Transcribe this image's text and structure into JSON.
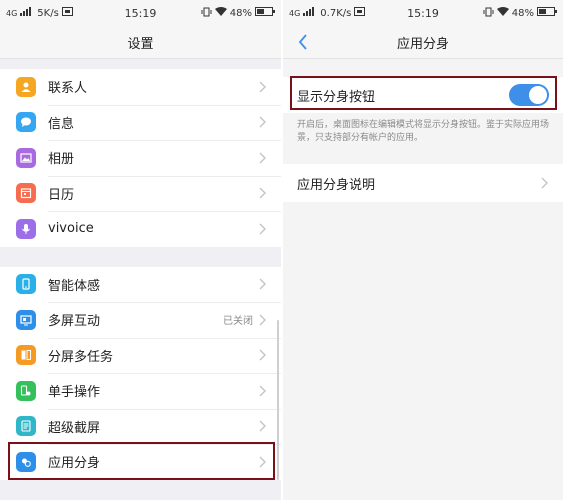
{
  "left_screen": {
    "status_bar": {
      "network": "4G",
      "speed": "5K/s",
      "time": "15:19",
      "battery": "48%"
    },
    "title": "设置",
    "group1": [
      {
        "label": "联系人",
        "icon": "contacts-icon",
        "color": "#f5a623"
      },
      {
        "label": "信息",
        "icon": "message-icon",
        "color": "#35a7f2"
      },
      {
        "label": "相册",
        "icon": "album-icon",
        "color": "#a969e0"
      },
      {
        "label": "日历",
        "icon": "calendar-icon",
        "color": "#f56c4e"
      },
      {
        "label": "vivoice",
        "icon": "microphone-icon",
        "color": "#9c6fe8"
      }
    ],
    "group2": [
      {
        "label": "智能体感",
        "icon": "motion-icon",
        "color": "#2ab0e8",
        "status": ""
      },
      {
        "label": "多屏互动",
        "icon": "multiscreen-icon",
        "color": "#2d8fe8",
        "status": "已关闭"
      },
      {
        "label": "分屏多任务",
        "icon": "split-screen-icon",
        "color": "#f59a23",
        "status": ""
      },
      {
        "label": "单手操作",
        "icon": "one-hand-icon",
        "color": "#34c05b",
        "status": ""
      },
      {
        "label": "超级截屏",
        "icon": "screenshot-icon",
        "color": "#2fb7c9",
        "status": ""
      },
      {
        "label": "应用分身",
        "icon": "app-clone-icon",
        "color": "#2d8fe8",
        "status": ""
      }
    ]
  },
  "right_screen": {
    "status_bar": {
      "network": "4G",
      "speed": "0.7K/s",
      "time": "15:19",
      "battery": "48%"
    },
    "title": "应用分身",
    "toggle": {
      "label": "显示分身按钮",
      "on": true
    },
    "description": "开启后，桌面图标在编辑模式将显示分身按钮。鉴于实际应用场景，只支持部分有帐户的应用。",
    "info_row": "应用分身说明"
  },
  "colors": {
    "highlight_box": "#7a1018",
    "toggle_on": "#3d8fe8"
  }
}
